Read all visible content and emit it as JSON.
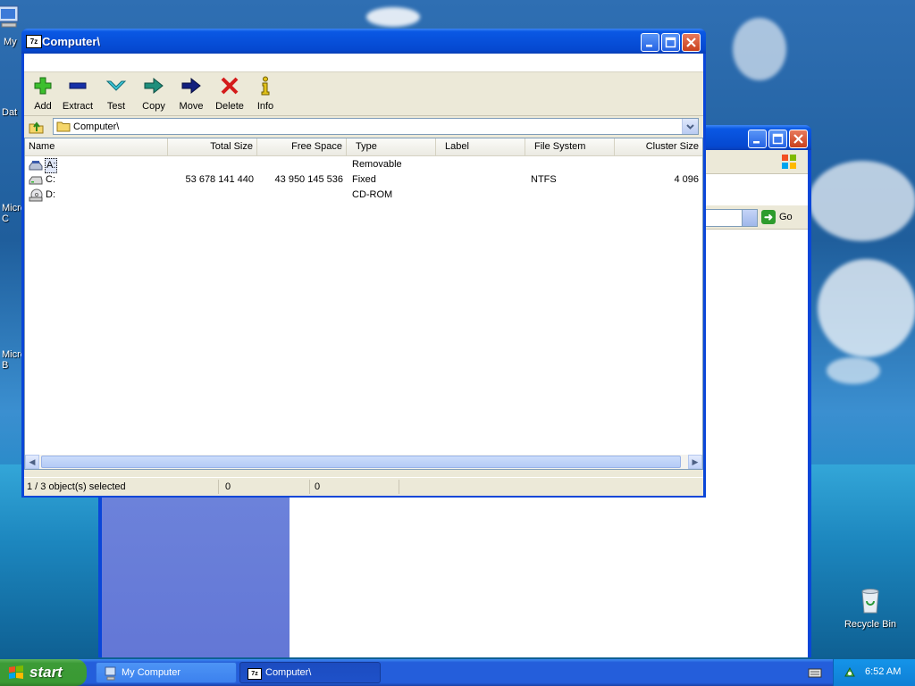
{
  "desktop": {
    "icons": [
      {
        "label": "My",
        "top": 0
      },
      {
        "label": "Dat",
        "top": 0
      },
      {
        "label": "Micro\nC",
        "top": 0
      },
      {
        "label": "Micro\nB",
        "top": 0
      }
    ],
    "recycle_bin": "Recycle Bin"
  },
  "background_window": {
    "go_label": "Go"
  },
  "window": {
    "title": "Computer\\",
    "app_icon_text": "7z"
  },
  "toolbar": {
    "buttons": [
      {
        "label": "Add",
        "icon": "add-icon"
      },
      {
        "label": "Extract",
        "icon": "extract-icon"
      },
      {
        "label": "Test",
        "icon": "test-icon"
      },
      {
        "label": "Copy",
        "icon": "copy-icon"
      },
      {
        "label": "Move",
        "icon": "move-icon"
      },
      {
        "label": "Delete",
        "icon": "delete-icon"
      },
      {
        "label": "Info",
        "icon": "info-icon"
      }
    ]
  },
  "address": {
    "path": "Computer\\"
  },
  "list": {
    "columns": [
      "Name",
      "Total Size",
      "Free Space",
      "Type",
      "Label",
      "File System",
      "Cluster Size"
    ],
    "rows": [
      {
        "name": "A:",
        "total": "",
        "free": "",
        "type": "Removable",
        "label": "",
        "fs": "",
        "cluster": "",
        "selected": true,
        "icon": "floppy-drive-icon"
      },
      {
        "name": "C:",
        "total": "53 678 141 440",
        "free": "43 950 145 536",
        "type": "Fixed",
        "label": "",
        "fs": "NTFS",
        "cluster": "4 096",
        "selected": false,
        "icon": "hard-drive-icon"
      },
      {
        "name": "D:",
        "total": "",
        "free": "",
        "type": "CD-ROM",
        "label": "",
        "fs": "",
        "cluster": "",
        "selected": false,
        "icon": "cd-drive-icon"
      }
    ]
  },
  "status": {
    "selection": "1 / 3 object(s) selected",
    "size": "0",
    "packed": "0"
  },
  "taskbar": {
    "start_label": "start",
    "tasks": [
      {
        "label": "My Computer",
        "active": false
      },
      {
        "label": "Computer\\",
        "active": true
      }
    ],
    "clock": "6:52 AM"
  }
}
